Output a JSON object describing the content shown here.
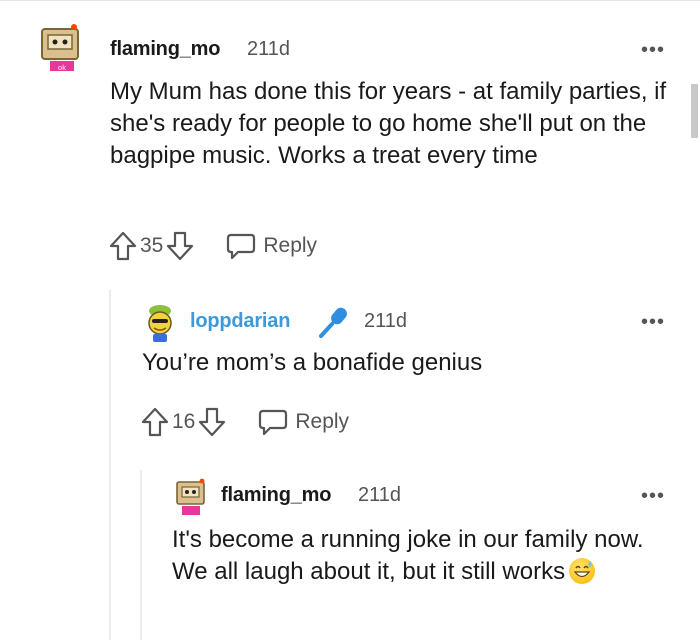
{
  "comments": [
    {
      "author": "flaming_mo",
      "age": "211d",
      "more": "•••",
      "text": "My Mum has done this for years - at family parties, if she's ready for people to go home she'll put on the bagpipe music. Works a treat every time",
      "votes": "35",
      "reply_label": "Reply"
    },
    {
      "author": "loppdarian",
      "age": "211d",
      "more": "•••",
      "text": "You’re mom’s a bonafide genius",
      "votes": "16",
      "reply_label": "Reply"
    },
    {
      "author": "flaming_mo",
      "age": "211d",
      "more": "•••",
      "text": "It's become a running joke in our family now. We all laugh about it, but it still works",
      "emoji": "grinning-sweat-emoji"
    }
  ],
  "colors": {
    "text": "#1a1a1b",
    "meta": "#555555",
    "flair_blue": "#3b9ad9",
    "thread_line": "#ececec"
  },
  "icons": [
    "upvote-icon",
    "downvote-icon",
    "reply-icon",
    "more-icon",
    "microphone-icon"
  ]
}
